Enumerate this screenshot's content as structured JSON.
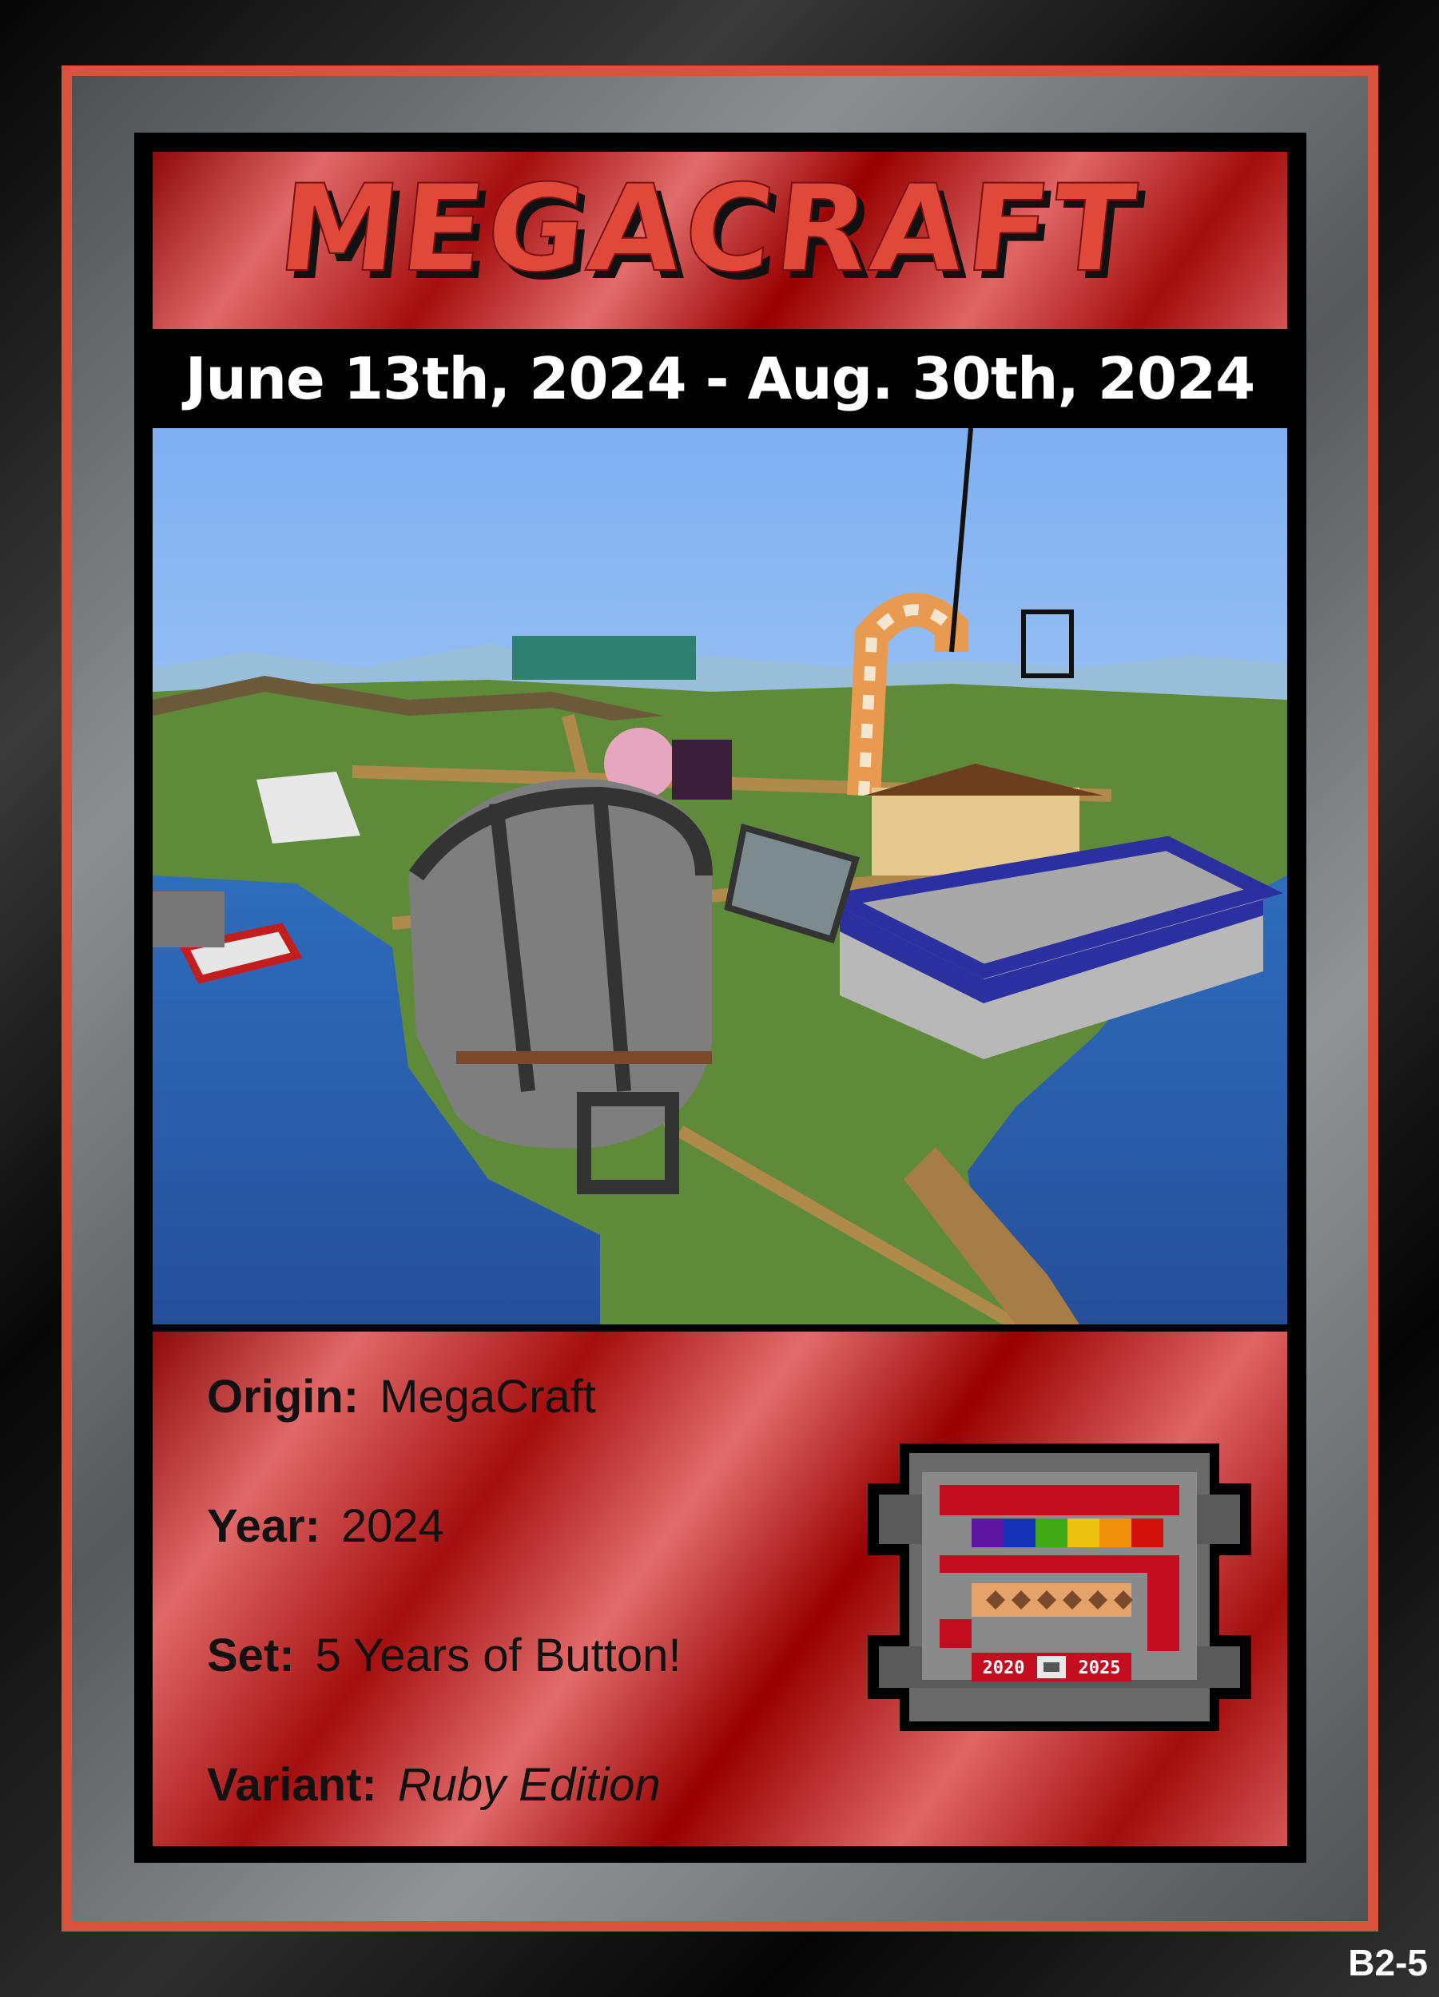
{
  "card": {
    "logo_text": "MEGACRAFT",
    "date_range": "June 13th, 2024 - Aug. 30th, 2024",
    "fields": [
      {
        "label": "Origin:",
        "value": "MegaCraft"
      },
      {
        "label": "Year:",
        "value": "2024"
      },
      {
        "label": "Set:",
        "value": "5 Years of Button!"
      },
      {
        "label": "Variant:",
        "value": "Ruby Edition"
      }
    ],
    "emblem": {
      "year_left": "2020",
      "year_right": "2025"
    },
    "card_code": "B2-5"
  },
  "colors": {
    "frame_accent": "#d9533c",
    "logo_red": "#e0483a",
    "ruby_dark": "#990000",
    "ruby_light": "#e06868"
  },
  "image": {
    "subject": "minecraft-world-screenshot"
  }
}
